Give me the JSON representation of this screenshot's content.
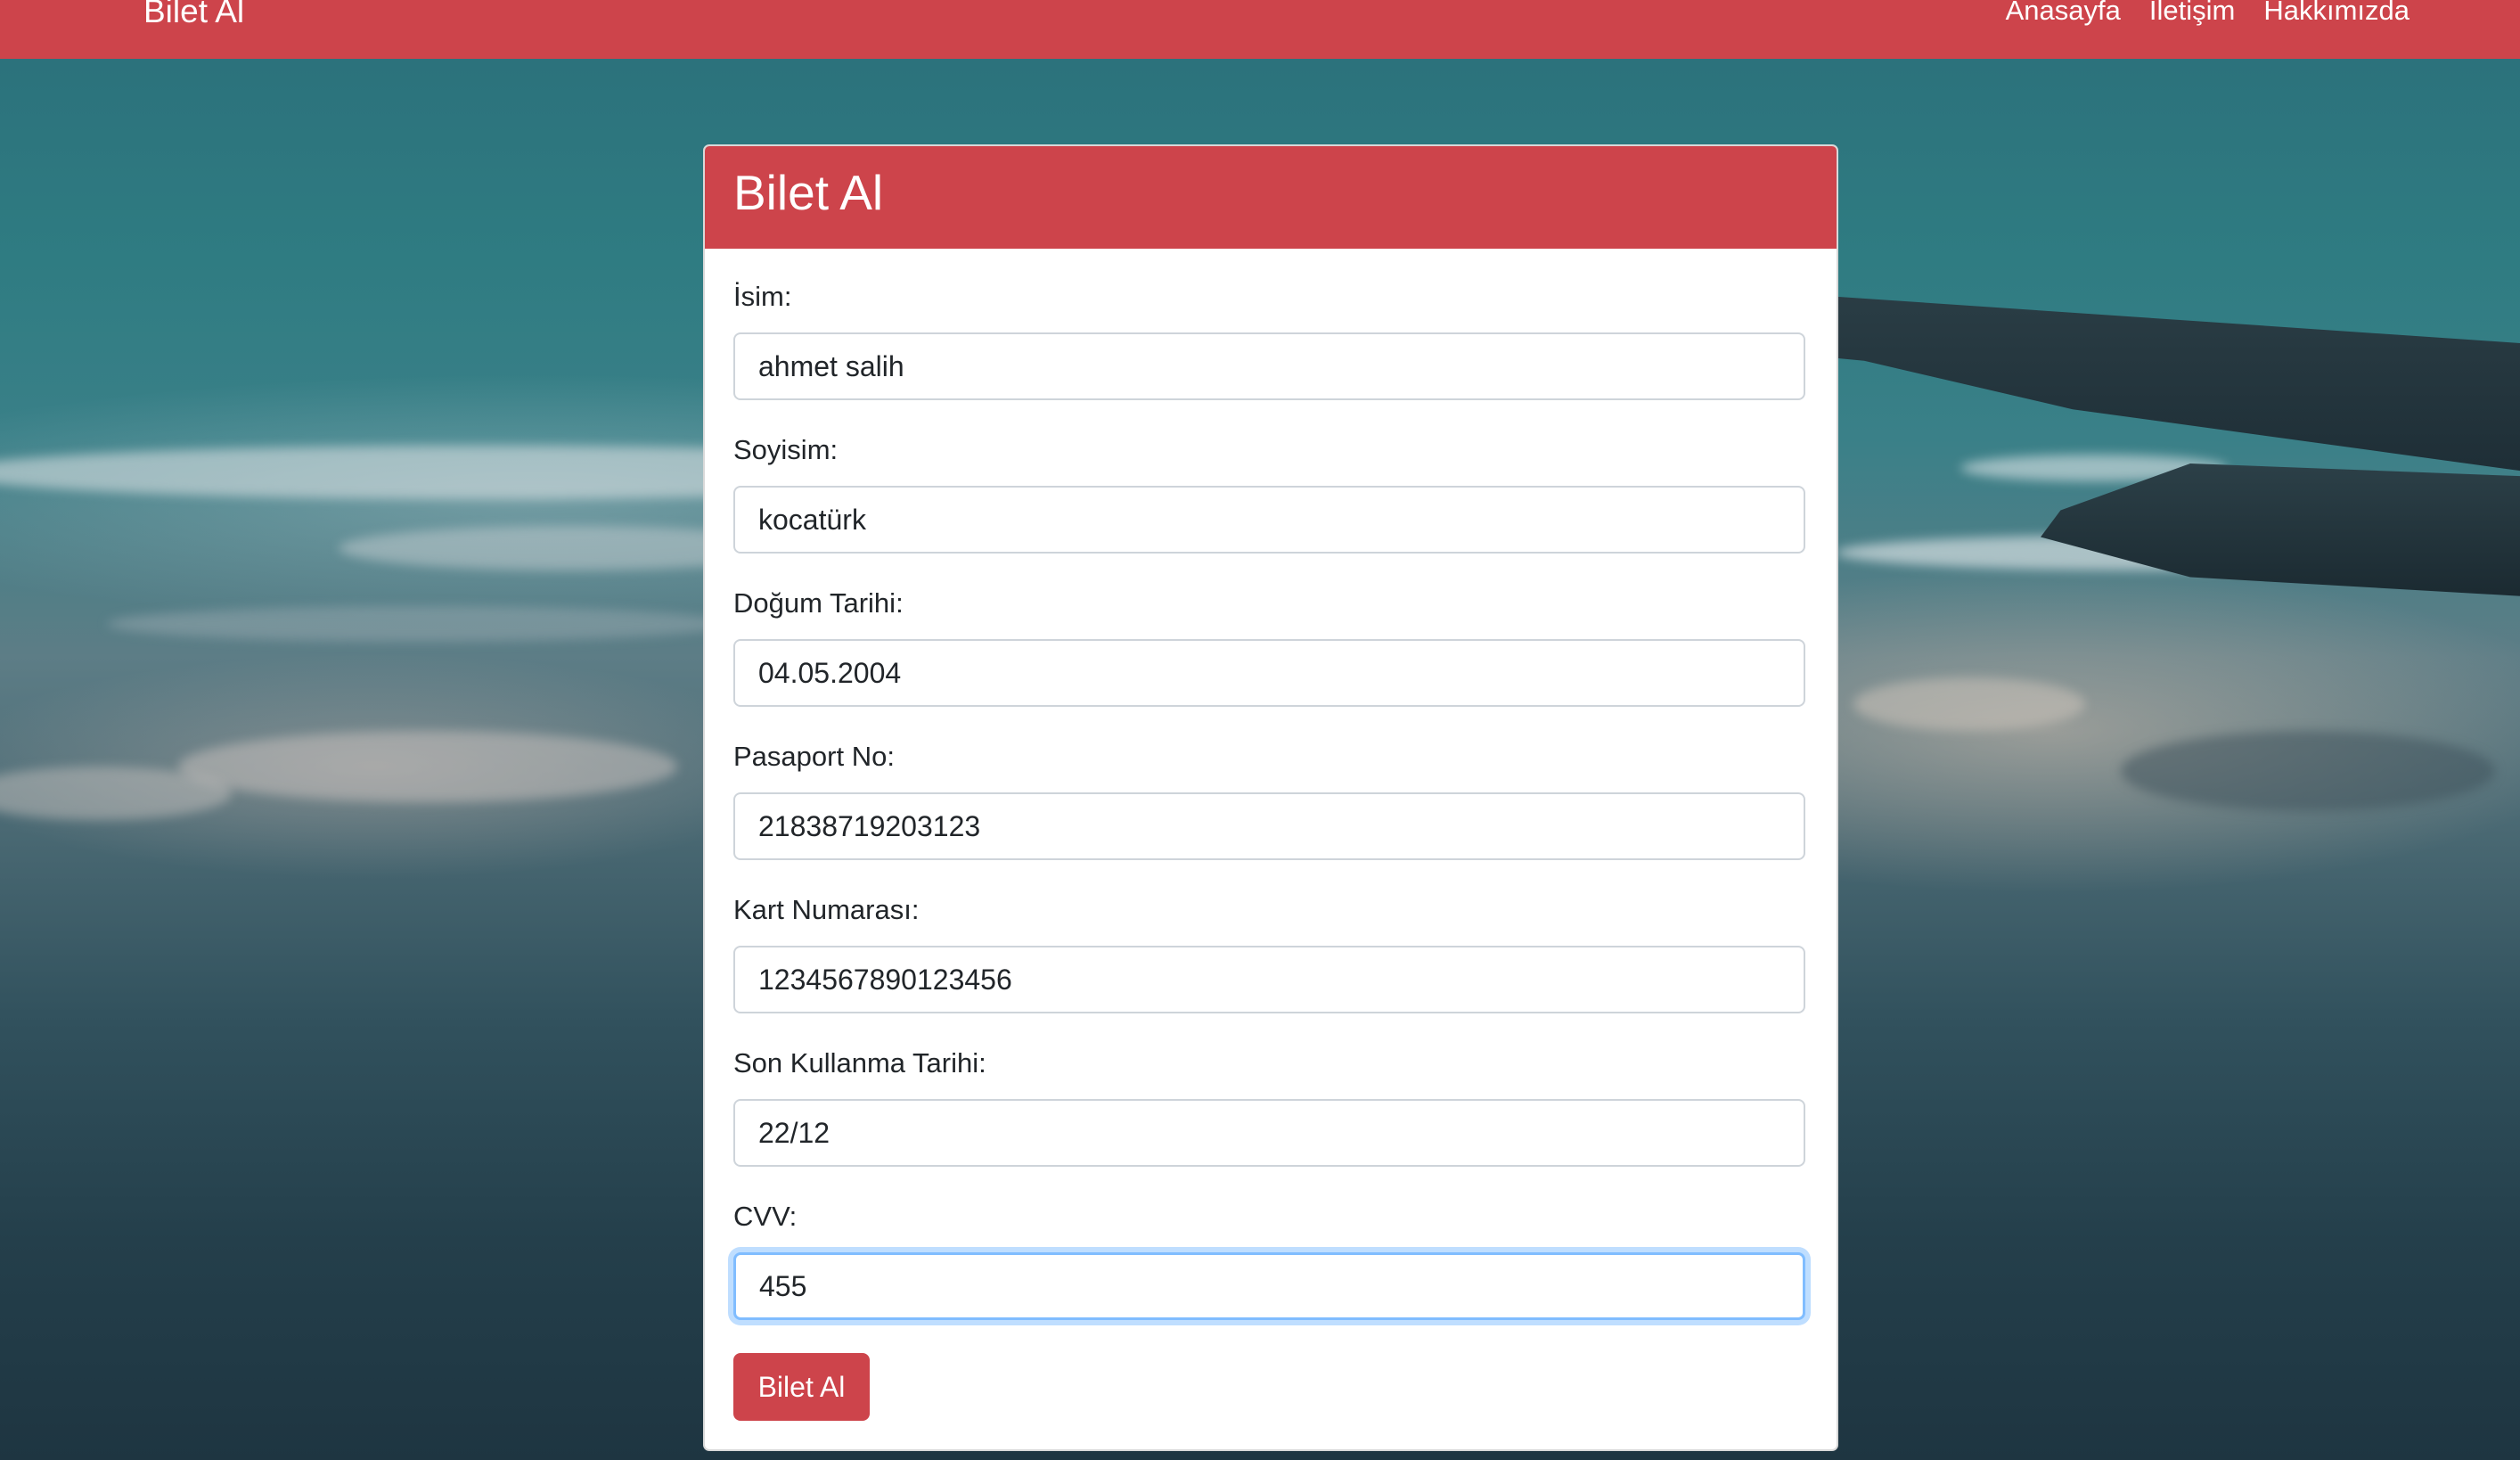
{
  "navbar": {
    "brand": "Bilet Al",
    "links": [
      "Anasayfa",
      "İletişim",
      "Hakkımızda"
    ],
    "color": "#cd444b"
  },
  "card": {
    "title": "Bilet Al",
    "fields": [
      {
        "label": "İsim:",
        "value": "ahmet salih"
      },
      {
        "label": "Soyisim:",
        "value": "kocatürk"
      },
      {
        "label": "Doğum Tarihi:",
        "value": "04.05.2004"
      },
      {
        "label": "Pasaport No:",
        "value": "21838719203123"
      },
      {
        "label": "Kart Numarası:",
        "value": "1234567890123456"
      },
      {
        "label": "Son Kullanma Tarihi:",
        "value": "22/12"
      },
      {
        "label": "CVV:",
        "value": "455"
      }
    ],
    "submit_label": "Bilet Al"
  }
}
